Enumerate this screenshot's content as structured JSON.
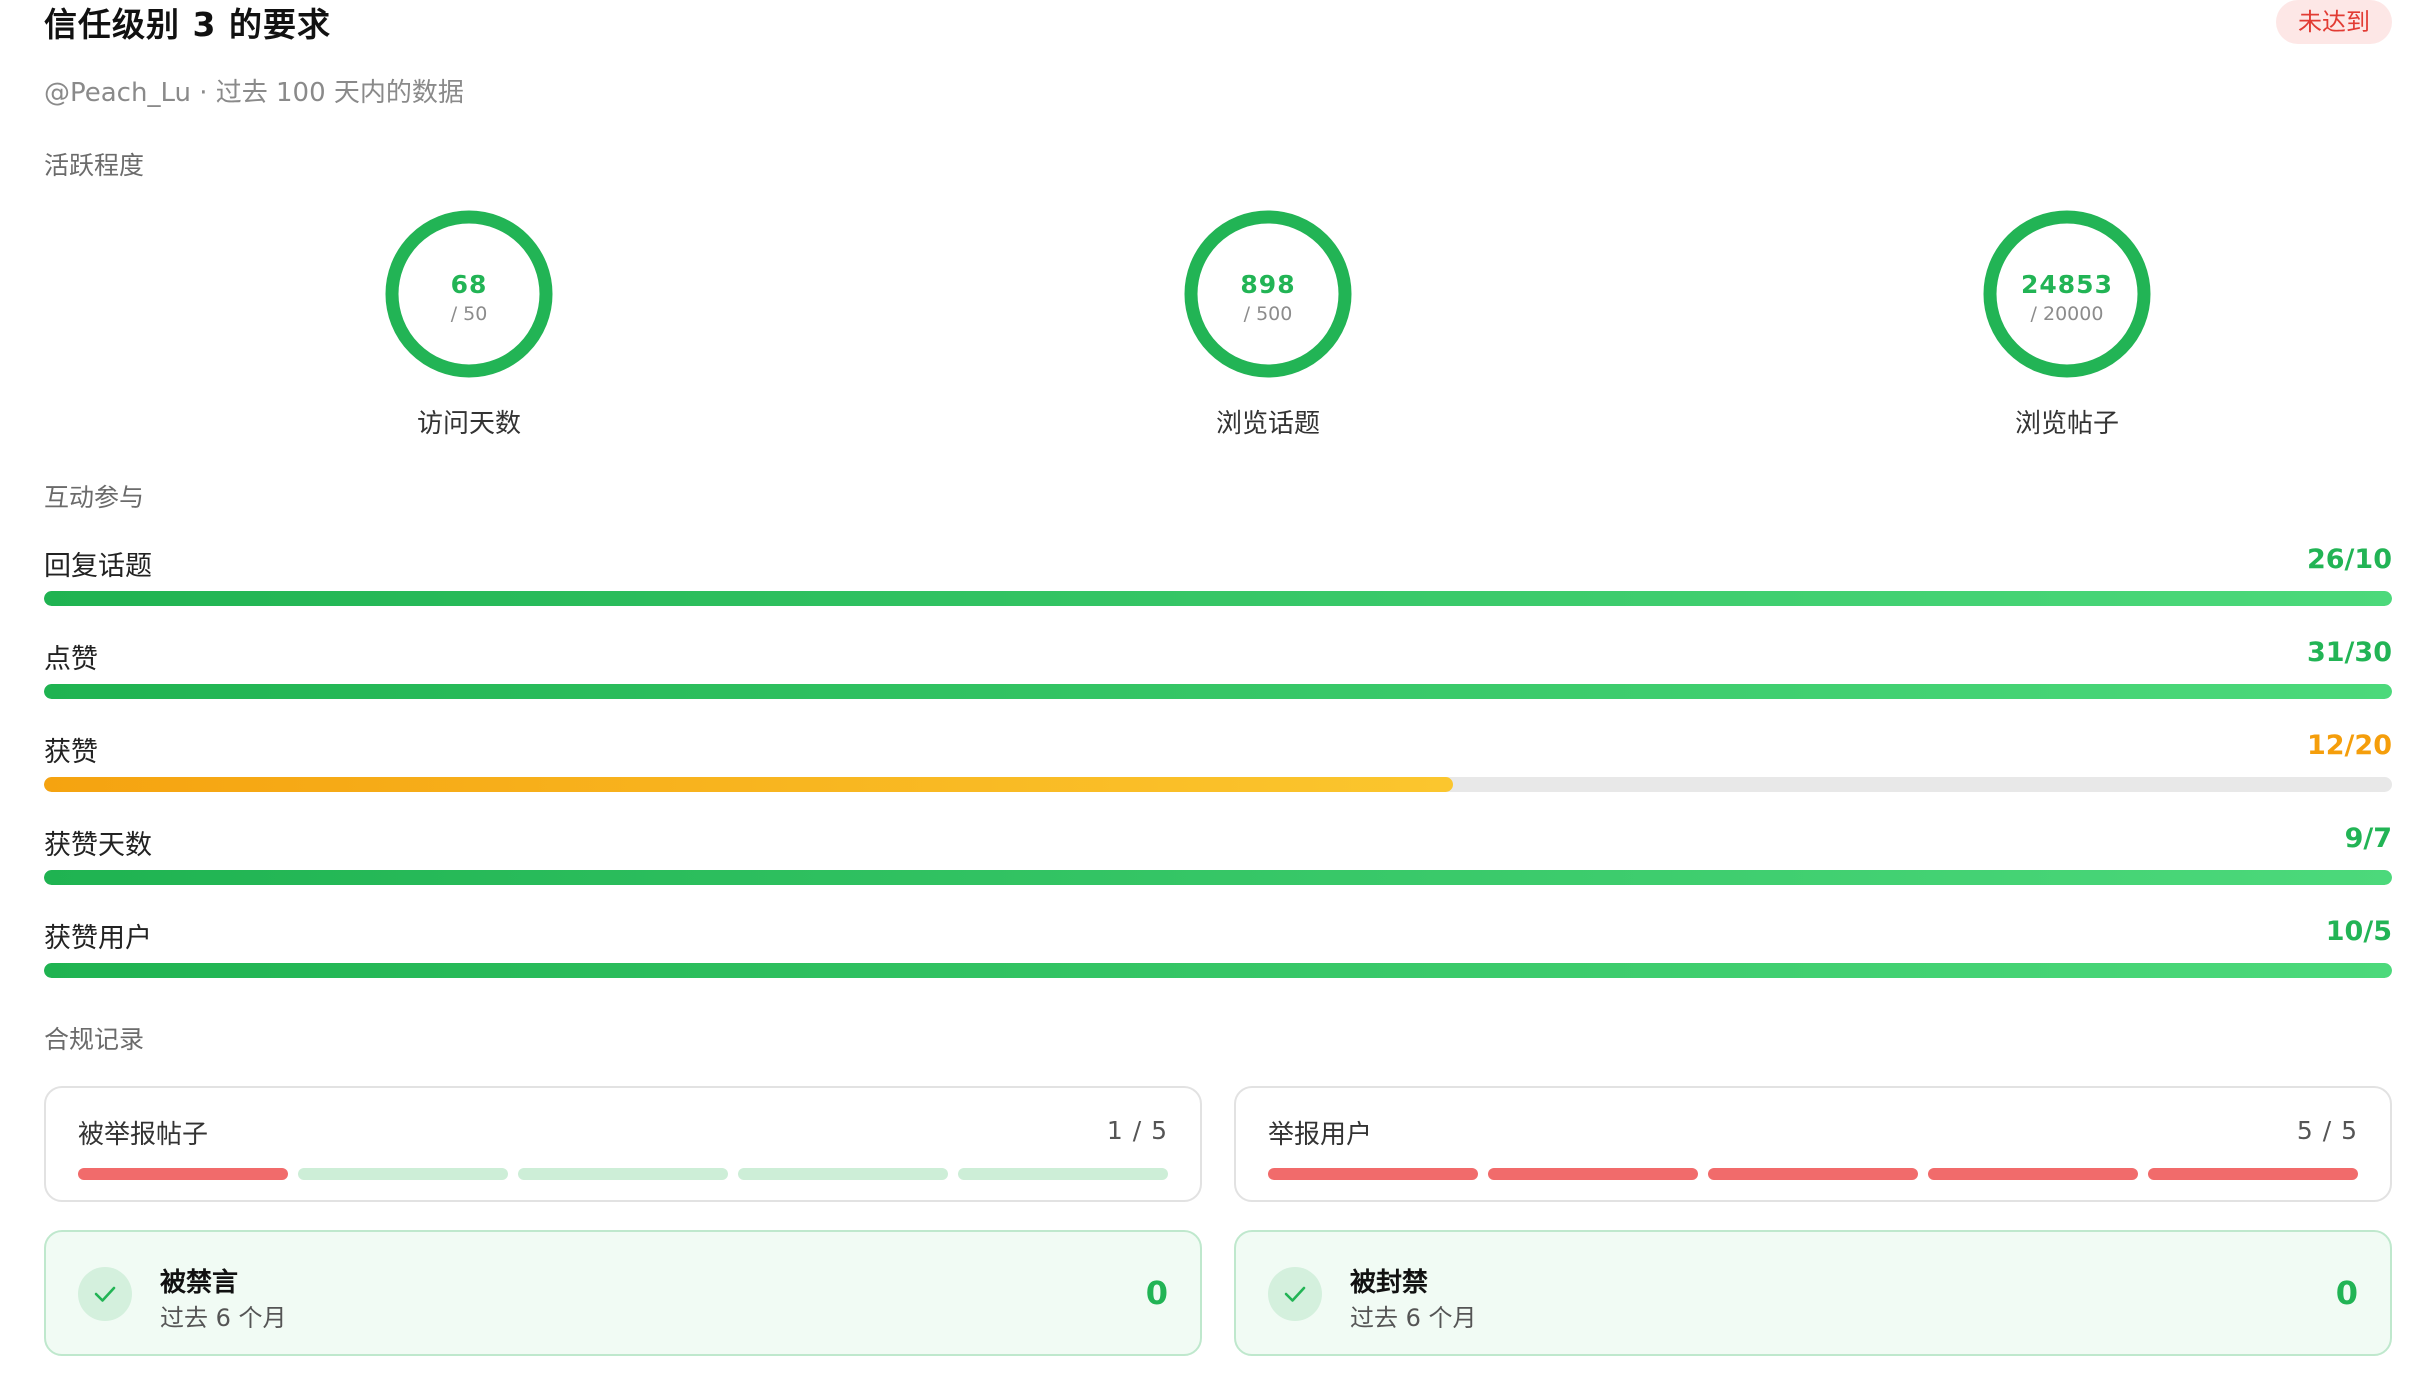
{
  "header": {
    "title": "信任级别 3 的要求",
    "status_badge": "未达到",
    "subtitle": "@Peach_Lu · 过去 100 天内的数据"
  },
  "sections": {
    "activity": "活跃程度",
    "interaction": "互动参与",
    "compliance": "合规记录"
  },
  "rings": [
    {
      "value": "68",
      "target": "/ 50",
      "label": "访问天数",
      "progress": 1.0
    },
    {
      "value": "898",
      "target": "/ 500",
      "label": "浏览话题",
      "progress": 1.0
    },
    {
      "value": "24853",
      "target": "/ 20000",
      "label": "浏览帖子",
      "progress": 1.0
    }
  ],
  "progress_rows": [
    {
      "label": "回复话题",
      "value_text": "26/10",
      "progress": 1.0,
      "status": "ok"
    },
    {
      "label": "点赞",
      "value_text": "31/30",
      "progress": 1.0,
      "status": "ok"
    },
    {
      "label": "获赞",
      "value_text": "12/20",
      "progress": 0.6,
      "status": "warn"
    },
    {
      "label": "获赞天数",
      "value_text": "9/7",
      "progress": 1.0,
      "status": "ok"
    },
    {
      "label": "获赞用户",
      "value_text": "10/5",
      "progress": 1.0,
      "status": "ok"
    }
  ],
  "compliance_cards": [
    {
      "label": "被举报帖子",
      "count_text": "1 / 5",
      "filled": 1,
      "total": 5
    },
    {
      "label": "举报用户",
      "count_text": "5 / 5",
      "filled": 5,
      "total": 5
    }
  ],
  "status_cards": [
    {
      "title": "被禁言",
      "subtitle": "过去 6 个月",
      "value": "0"
    },
    {
      "title": "被封禁",
      "subtitle": "过去 6 个月",
      "value": "0"
    }
  ],
  "colors": {
    "success": "#22b455",
    "warning": "#f59e0b",
    "danger": "#e23b33",
    "segment_on": "#f16b6b",
    "segment_off": "#cdeed7"
  },
  "icons": {
    "check": "check-icon"
  }
}
